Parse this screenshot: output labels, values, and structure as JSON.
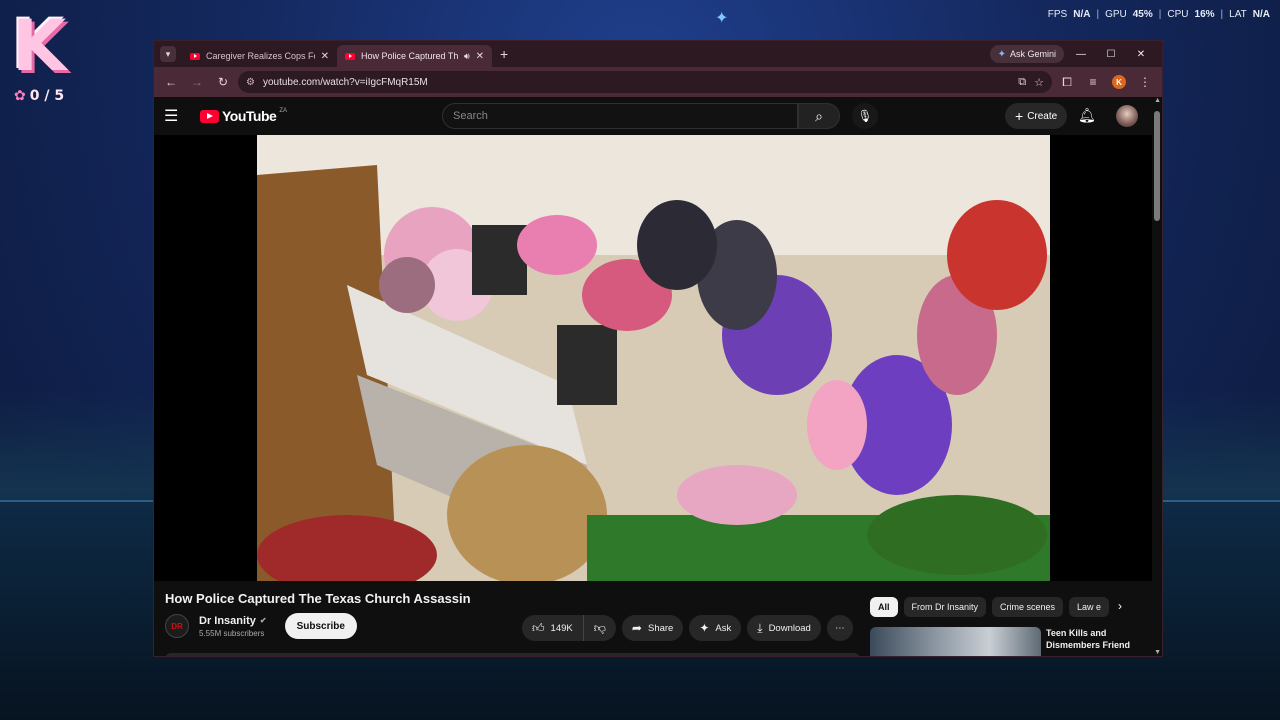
{
  "desktop": {
    "badge_count": "0 / 5",
    "logo_letter": "K"
  },
  "perf": {
    "fps_label": "FPS",
    "fps_value": "N/A",
    "gpu_label": "GPU",
    "gpu_value": "45",
    "cpu_label": "CPU",
    "cpu_value": "16",
    "lat_label": "LAT",
    "lat_value": "N/A"
  },
  "browser": {
    "tabs": [
      {
        "title": "Caregiver Realizes Cops Found",
        "active": false
      },
      {
        "title": "How Police Captured The Te",
        "active": true
      }
    ],
    "gemini_label": "Ask Gemini",
    "url": "youtube.com/watch?v=iIgcFMqR15M",
    "profile_initial": "K"
  },
  "youtube": {
    "logo_text": "YouTube",
    "region": "ZA",
    "search_placeholder": "Search",
    "create_label": "Create",
    "video_title": "How Police Captured The Texas Church Assassin",
    "channel_name": "Dr Insanity",
    "subscribers": "5.55M subscribers",
    "subscribe_label": "Subscribe",
    "likes": "149K",
    "share_label": "Share",
    "ask_label": "Ask",
    "download_label": "Download",
    "chips": [
      "All",
      "From Dr Insanity",
      "Crime scenes",
      "Law e"
    ],
    "recommended_title": "Teen Kills and Dismembers Friend"
  },
  "colors": {
    "youtube_red": "#ff0033",
    "browser_frame": "#2d1922",
    "toolbar": "#4a2a37"
  }
}
